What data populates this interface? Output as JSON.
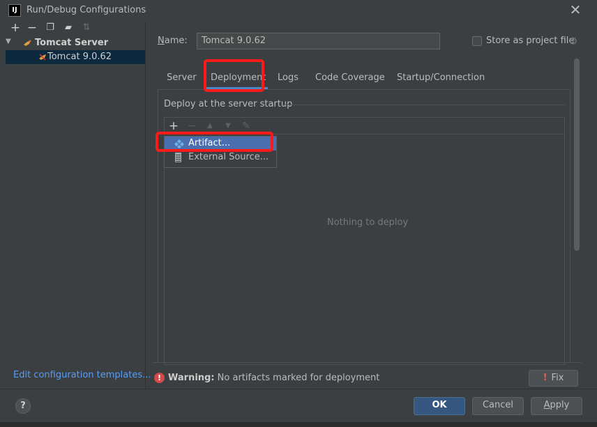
{
  "window": {
    "title": "Run/Debug Configurations",
    "app_icon_text": "IJ"
  },
  "sidebar": {
    "toolbar": [
      {
        "name": "add",
        "glyph": "+",
        "enabled": true
      },
      {
        "name": "remove",
        "glyph": "−",
        "enabled": true
      },
      {
        "name": "copy",
        "glyph": "❐",
        "enabled": true
      },
      {
        "name": "move-into-folder",
        "glyph": "▰",
        "enabled": true
      },
      {
        "name": "sort",
        "glyph": "⇅",
        "enabled": false
      }
    ],
    "group_label": "Tomcat Server",
    "item_label": "Tomcat 9.0.62",
    "edit_templates_label": "Edit configuration templates..."
  },
  "config": {
    "name_label": "Name:",
    "name_value": "Tomcat 9.0.62",
    "store_label": "Store as project file",
    "store_checked": false
  },
  "tabs": [
    {
      "label": "Server",
      "active": false
    },
    {
      "label": "Deployment",
      "active": true
    },
    {
      "label": "Logs",
      "active": false
    },
    {
      "label": "Code Coverage",
      "active": false
    },
    {
      "label": "Startup/Connection",
      "active": false
    }
  ],
  "deployment": {
    "section_title": "Deploy at the server startup",
    "empty_text": "Nothing to deploy",
    "popup_items": [
      {
        "label": "Artifact...",
        "selected": true
      },
      {
        "label": "External Source...",
        "selected": false
      }
    ]
  },
  "warning": {
    "bold": "Warning:",
    "text": " No artifacts marked for deployment",
    "fix_label": "Fix"
  },
  "buttons": {
    "help": "?",
    "ok": "OK",
    "cancel": "Cancel",
    "apply": "Apply"
  },
  "colors": {
    "background": "#3c3f41",
    "accent": "#4a88c7",
    "selection": "#4b6eaf",
    "link": "#589df6",
    "highlight_box": "#ff1a1a",
    "warning": "#d44a4a"
  }
}
